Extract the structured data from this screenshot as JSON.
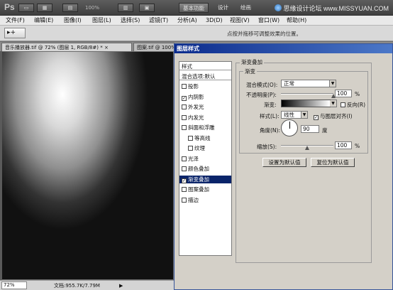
{
  "appbar": {
    "logo": "Ps",
    "zoom": "100%",
    "workspace_tabs": [
      "基本功能",
      "设计",
      "绘画"
    ],
    "active_workspace": "基本功能",
    "watermark": "思缘设计论坛 www.MISSYUAN.COM"
  },
  "menu": {
    "items": [
      "文件(F)",
      "编辑(E)",
      "图像(I)",
      "图层(L)",
      "选择(S)",
      "滤镜(T)",
      "分析(A)",
      "3D(D)",
      "视图(V)",
      "窗口(W)",
      "帮助(H)"
    ]
  },
  "options": {
    "tool_glyph": "▸+",
    "hint": "点按并拖移可调整效果的位置。"
  },
  "doc_tabs": [
    {
      "label": "音乐播放器.tif @ 72% (图层 1, RGB/8#) *",
      "close": "×",
      "active": true
    },
    {
      "label": "图案.tif @ 100% (",
      "close": "×",
      "active": false
    }
  ],
  "status": {
    "zoom": "72%",
    "doc_info": "文档:955.7K/7.79M",
    "arrow": "▶"
  },
  "dialog": {
    "title": "图层样式",
    "list_header": "样式",
    "blend_options": "混合选项:默认",
    "styles": [
      {
        "label": "投影",
        "checked": false,
        "indent": false,
        "selected": false
      },
      {
        "label": "内阴影",
        "checked": true,
        "indent": false,
        "selected": false
      },
      {
        "label": "外发光",
        "checked": false,
        "indent": false,
        "selected": false
      },
      {
        "label": "内发光",
        "checked": false,
        "indent": false,
        "selected": false
      },
      {
        "label": "斜面和浮雕",
        "checked": false,
        "indent": false,
        "selected": false
      },
      {
        "label": "等高线",
        "checked": false,
        "indent": true,
        "selected": false
      },
      {
        "label": "纹理",
        "checked": false,
        "indent": true,
        "selected": false
      },
      {
        "label": "光泽",
        "checked": false,
        "indent": false,
        "selected": false
      },
      {
        "label": "颜色叠加",
        "checked": false,
        "indent": false,
        "selected": false
      },
      {
        "label": "渐变叠加",
        "checked": true,
        "indent": false,
        "selected": true
      },
      {
        "label": "图案叠加",
        "checked": false,
        "indent": false,
        "selected": false
      },
      {
        "label": "描边",
        "checked": false,
        "indent": false,
        "selected": false
      }
    ],
    "outer_group_title": "渐变叠加",
    "inner_group_title": "渐变",
    "blend_mode_label": "混合模式(O):",
    "blend_mode_value": "正常",
    "opacity_label": "不透明度(P):",
    "opacity_value": "100",
    "opacity_fraction": 1.0,
    "percent": "%",
    "gradient_label": "渐变:",
    "reverse_label": "反向(R)",
    "reverse_checked": false,
    "style_label": "样式(L):",
    "style_value": "线性",
    "align_label": "与图层对齐(I)",
    "align_checked": true,
    "angle_label": "角度(N):",
    "angle_value": "90",
    "degree": "度",
    "scale_label": "缩放(S):",
    "scale_value": "100",
    "scale_fraction": 0.5,
    "btn_default_set": "设置为默认值",
    "btn_default_reset": "复位为默认值"
  }
}
